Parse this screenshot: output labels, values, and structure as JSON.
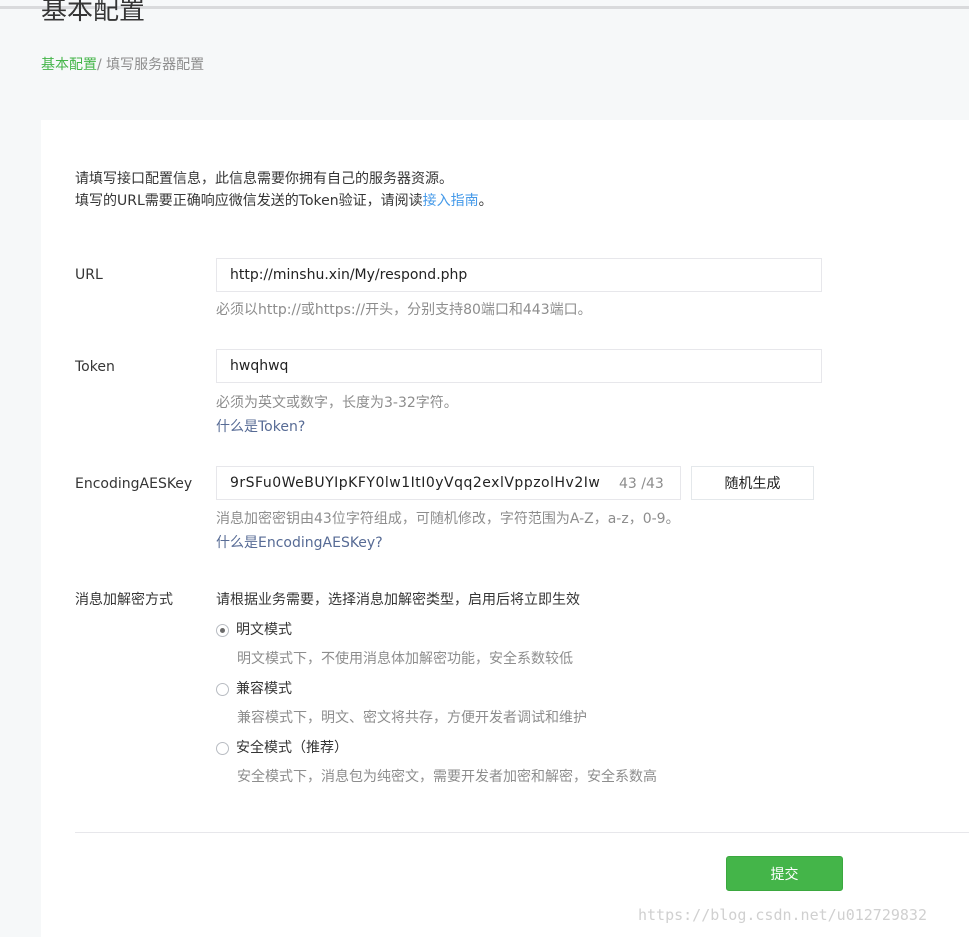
{
  "page": {
    "title": "基本配置"
  },
  "breadcrumb": {
    "home": "基本配置",
    "separator": "/",
    "current": " 填写服务器配置"
  },
  "intro": {
    "line1": "请填写接口配置信息，此信息需要你拥有自己的服务器资源。",
    "line2_prefix": "填写的URL需要正确响应微信发送的Token验证，请阅读",
    "line2_link": "接入指南",
    "line2_suffix": "。"
  },
  "url": {
    "label": "URL",
    "value": "http://minshu.xin/My/respond.php",
    "tip": "必须以http://或https://开头，分别支持80端口和443端口。"
  },
  "token": {
    "label": "Token",
    "value": "hwqhwq",
    "tip": "必须为英文或数字，长度为3-32字符。",
    "help_link": "什么是Token?"
  },
  "aes_key": {
    "label": "EncodingAESKey",
    "value": "9rSFu0WeBUYIpKFY0lw1ItI0yVqq2exlVppzolHv2Iw",
    "counter": "43 /43",
    "random_button": "随机生成",
    "tip": "消息加密密钥由43位字符组成，可随机修改，字符范围为A-Z，a-z，0-9。",
    "help_link": "什么是EncodingAESKey?"
  },
  "encryption": {
    "label": "消息加解密方式",
    "prompt": "请根据业务需要，选择消息加解密类型，启用后将立即生效",
    "options": [
      {
        "label": "明文模式",
        "desc": "明文模式下，不使用消息体加解密功能，安全系数较低",
        "checked": true
      },
      {
        "label": "兼容模式",
        "desc": "兼容模式下，明文、密文将共存，方便开发者调试和维护",
        "checked": false
      },
      {
        "label": "安全模式（推荐）",
        "desc": "安全模式下，消息包为纯密文，需要开发者加密和解密，安全系数高",
        "checked": false
      }
    ]
  },
  "submit_label": "提交",
  "watermark": "https://blog.csdn.net/u012729832",
  "colors": {
    "accent_green": "#44b549",
    "link_blue": "#576b95",
    "intro_link_blue": "#459ae9",
    "tip_gray": "#8d8d8d"
  }
}
